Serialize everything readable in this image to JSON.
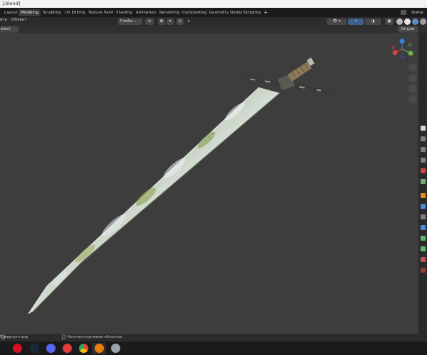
{
  "window": {
    "title": "].blend]"
  },
  "workspace_tabs": [
    {
      "label": "Layout"
    },
    {
      "label": "Modeling",
      "active": true
    },
    {
      "label": "Sculpting"
    },
    {
      "label": "UV Editing"
    },
    {
      "label": "Texture Paint"
    },
    {
      "label": "Shading"
    },
    {
      "label": "Animation"
    },
    {
      "label": "Rendering"
    },
    {
      "label": "Compositing"
    },
    {
      "label": "Geometry Nodes"
    },
    {
      "label": "Scripting"
    }
  ],
  "add_tab_label": "+",
  "scene": {
    "label": "Scene"
  },
  "header": {
    "select_mode": "elect Box",
    "transform_orientation": "Глоба…",
    "options_label": "Опции"
  },
  "menus": [
    "ить",
    "Объект"
  ],
  "statusbar": {
    "left": "Повернуть вид",
    "middle": "Контекстное меню объектов"
  },
  "gizmo": {
    "x": "X",
    "y": "Y",
    "z": "Z"
  },
  "taskbar_icons": [
    "opera-icon",
    "steam-icon",
    "discord-icon",
    "app-icon",
    "chrome-icon",
    "blender-icon",
    "app2-icon"
  ],
  "colors": {
    "viewport_bg": "#3d3d3d",
    "active_tab": "#3a3a3a",
    "axis_x": "#e0414b",
    "axis_y": "#6cb33f",
    "axis_z": "#3f7fe0"
  }
}
